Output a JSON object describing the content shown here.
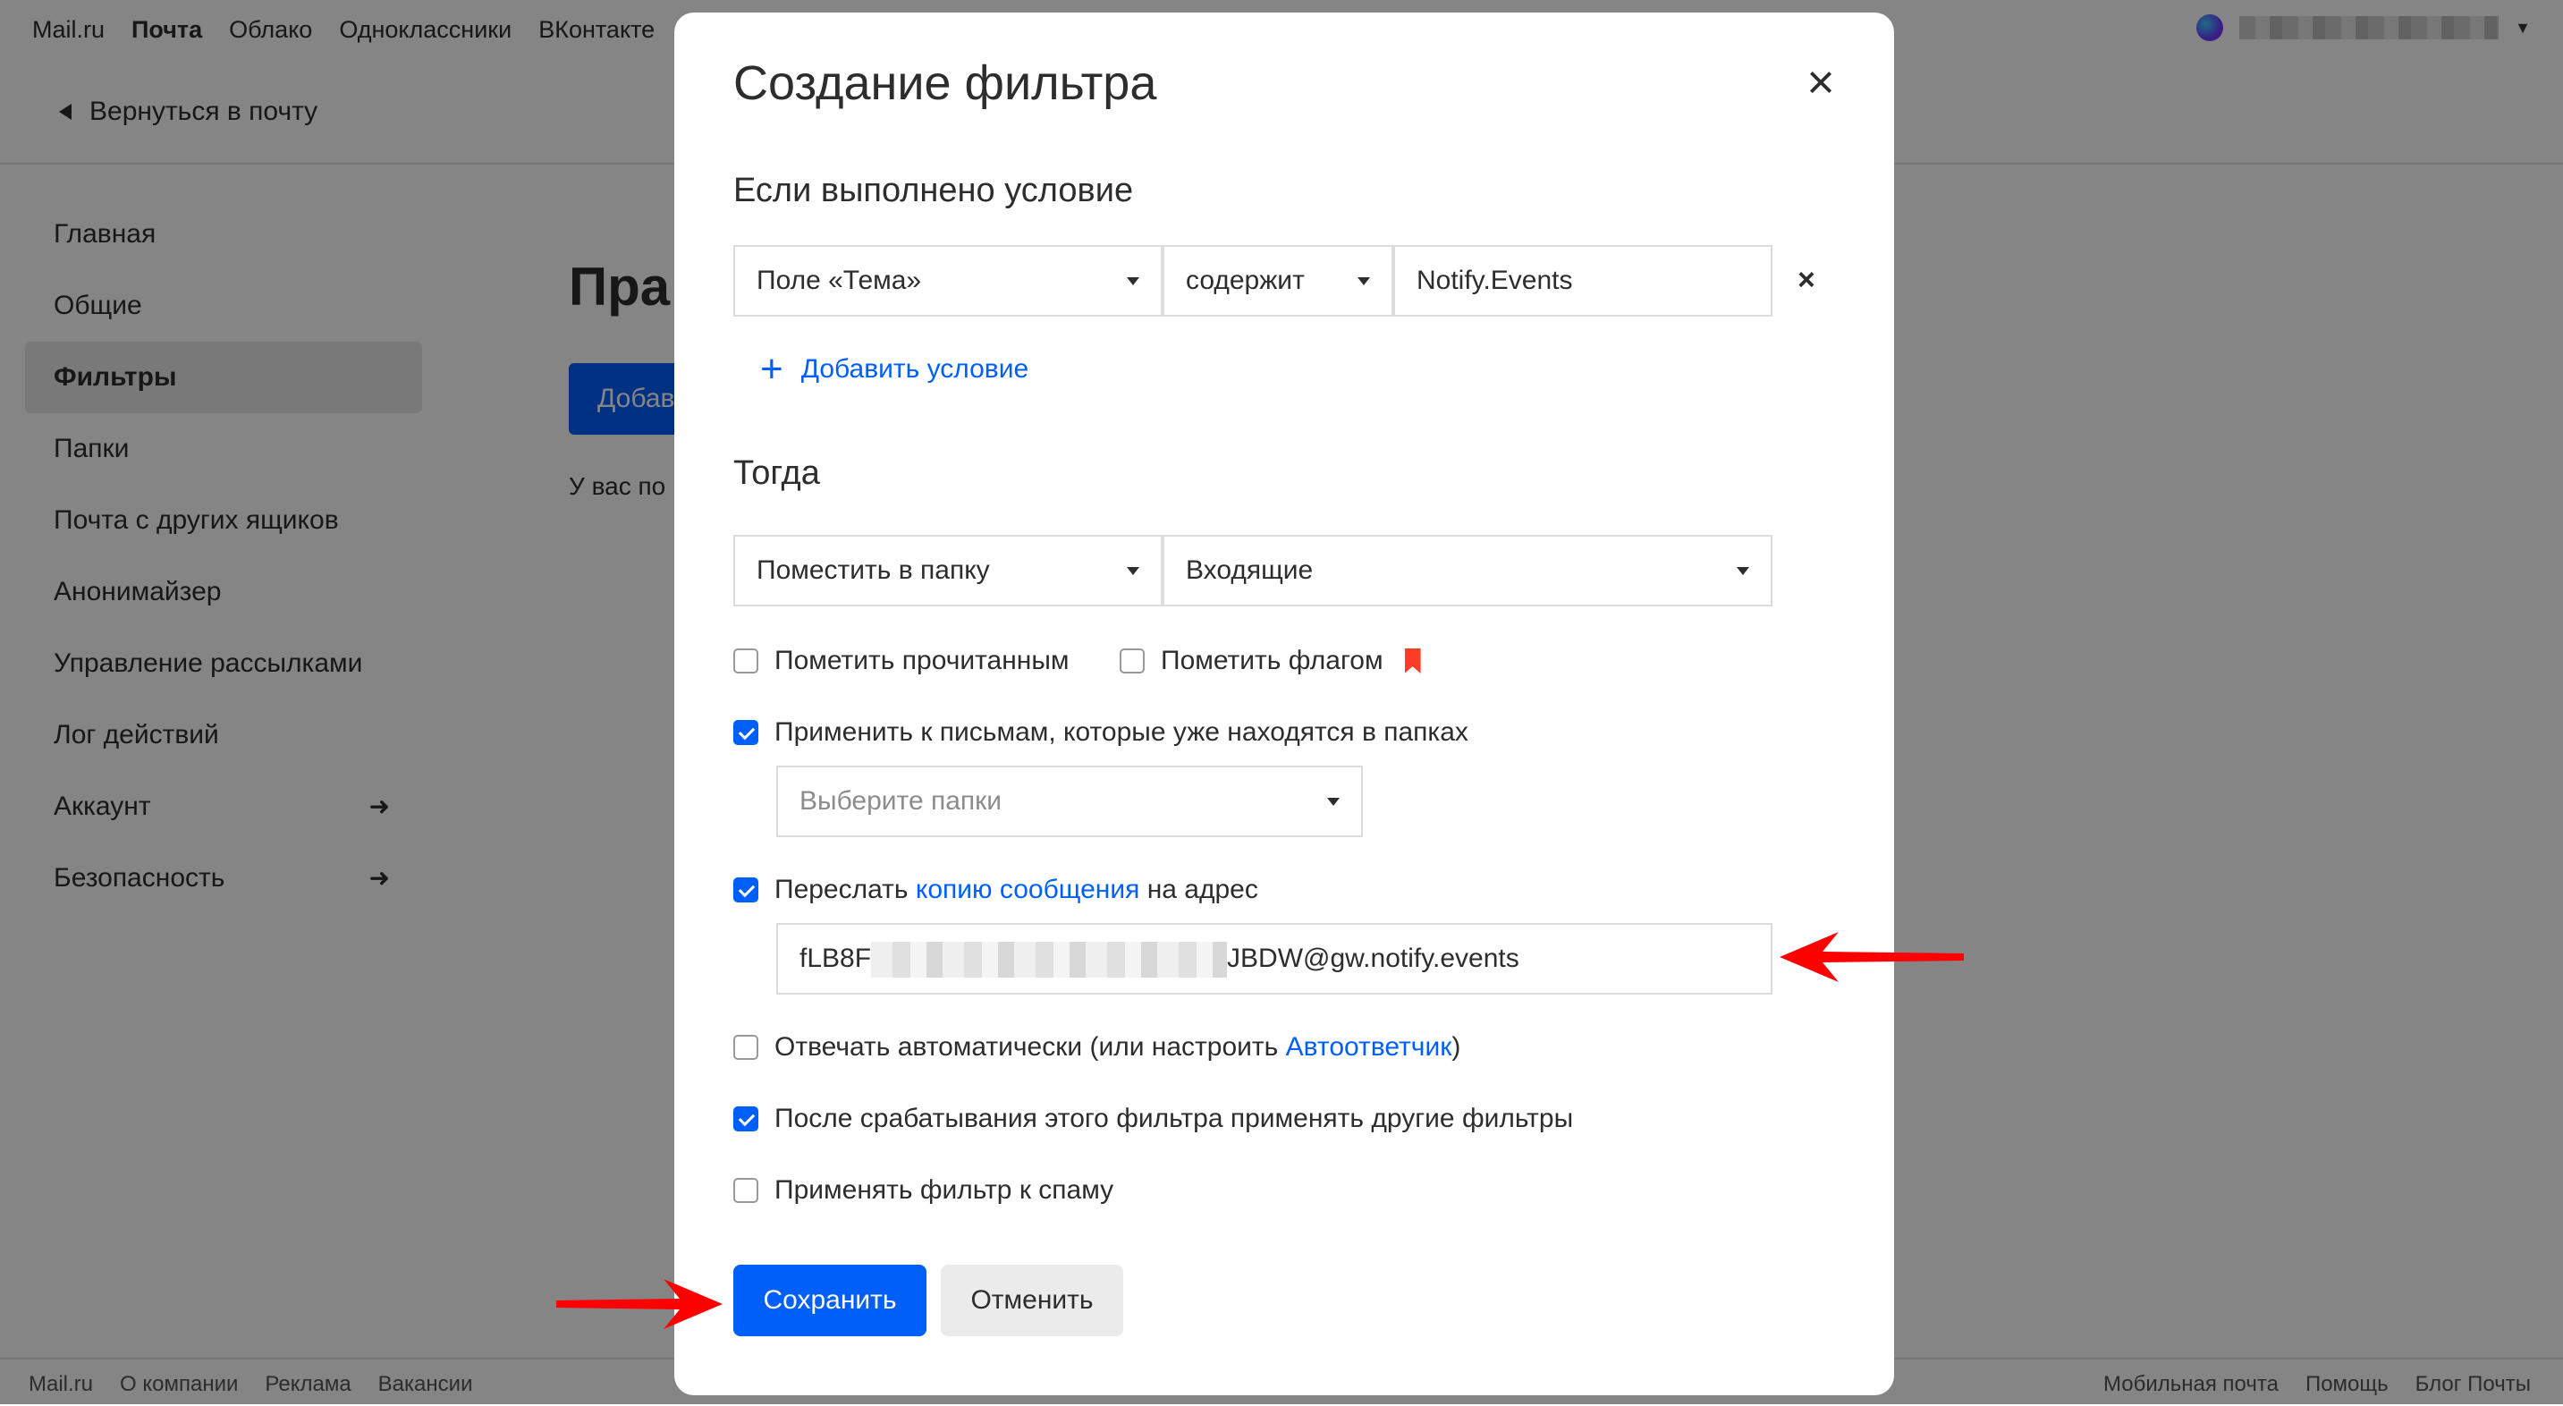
{
  "portal": {
    "links": [
      "Mail.ru",
      "Почта",
      "Облако",
      "Одноклассники",
      "ВКонтакте"
    ],
    "active_index": 1
  },
  "back_link": "Вернуться в почту",
  "sidebar": {
    "items": [
      {
        "label": "Главная",
        "arrow": ""
      },
      {
        "label": "Общие",
        "arrow": ""
      },
      {
        "label": "Фильтры",
        "arrow": ""
      },
      {
        "label": "Папки",
        "arrow": ""
      },
      {
        "label": "Почта с других ящиков",
        "arrow": ""
      },
      {
        "label": "Анонимайзер",
        "arrow": ""
      },
      {
        "label": "Управление рассылками",
        "arrow": ""
      },
      {
        "label": "Лог действий",
        "arrow": ""
      },
      {
        "label": "Аккаунт",
        "arrow": "➜"
      },
      {
        "label": "Безопасность",
        "arrow": "➜"
      }
    ],
    "active_index": 2
  },
  "content": {
    "title_partial": "Пра",
    "button_partial": "Добав",
    "note_partial": "У вас по"
  },
  "footer": {
    "left": [
      "Mail.ru",
      "О компании",
      "Реклама",
      "Вакансии"
    ],
    "right": [
      "Мобильная почта",
      "Помощь",
      "Блог Почты"
    ]
  },
  "modal": {
    "title": "Создание фильтра",
    "close_icon": "×",
    "condition_heading": "Если выполнено условие",
    "condition": {
      "field": "Поле «Тема»",
      "operator": "содержит",
      "value": "Notify.Events",
      "remove_icon": "×"
    },
    "add_condition_label": "Добавить условие",
    "action_heading": "Тогда",
    "action": {
      "type": "Поместить в папку",
      "folder": "Входящие"
    },
    "options": {
      "mark_read": {
        "label": "Пометить прочитанным",
        "checked": false
      },
      "mark_flag": {
        "label": "Пометить флагом",
        "checked": false
      },
      "apply_existing": {
        "label": "Применить к письмам, которые уже находятся в папках",
        "checked": true
      },
      "folders_placeholder": "Выберите папки",
      "forward": {
        "label_before": "Переслать",
        "link": "копию сообщения",
        "label_after": "на адрес",
        "checked": true
      },
      "forward_email_prefix": "fLB8F",
      "forward_email_suffix": "JBDW@gw.notify.events",
      "auto_reply": {
        "label_before": "Отвечать автоматически (или настроить",
        "link": "Автоответчик",
        "label_after": ")",
        "checked": false
      },
      "continue_filters": {
        "label": "После срабатывания этого фильтра применять другие фильтры",
        "checked": true
      },
      "apply_spam": {
        "label": "Применять фильтр к спаму",
        "checked": false
      }
    },
    "save_label": "Сохранить",
    "cancel_label": "Отменить"
  },
  "colors": {
    "accent": "#005ff9",
    "flag": "#ff3c26",
    "annotation_arrow": "#ff0000"
  }
}
